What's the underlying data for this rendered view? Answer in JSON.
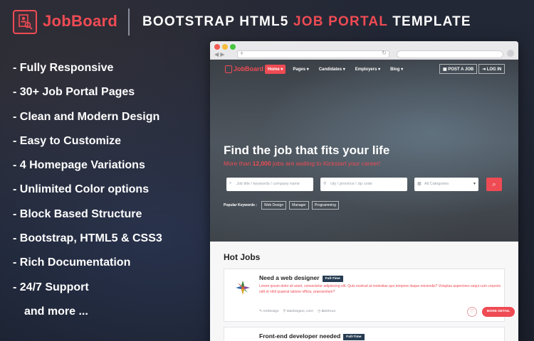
{
  "brand": {
    "logo_text": "JobBoard",
    "tagline_part1": "BOOTSTRAP HTML5 ",
    "tagline_part2": "JOB PORTAL",
    "tagline_part3": " TEMPLATE",
    "accent_color": "#ef4b54"
  },
  "features": [
    "- Fully Responsive",
    "- 30+ Job Portal Pages",
    "- Clean and Modern Design",
    "- Easy to Customize",
    "- 4 Homepage Variations",
    "- Unlimited Color options",
    "- Block Based Structure",
    "- Bootstrap, HTML5 & CSS3",
    "- Rich Documentation",
    "- 24/7 Support",
    "and more ..."
  ],
  "site": {
    "logo_text": "JobBoard",
    "menu": [
      "Home ▾",
      "Pages ▾",
      "Candidates ▾",
      "Employers ▾",
      "Blog ▾"
    ],
    "post_job": "POST A JOB",
    "login": "LOG IN",
    "hero_title": "Find the job that fits your life",
    "hero_sub_prefix": "More than ",
    "hero_sub_count": "12,000",
    "hero_sub_suffix": " jobs are waiting to Kickstart your career!",
    "keyword_placeholder": "Job title / keywords / company name",
    "location_placeholder": "city / province / zip code",
    "category_value": "All Categories",
    "popular_label": "Popular Keywords :",
    "popular_tags": [
      "Web Design",
      "Manager",
      "Programming"
    ]
  },
  "hot_jobs": {
    "title": "Hot Jobs",
    "jobs": [
      {
        "title": "Need a web designer",
        "type": "Full-Time",
        "description": "Lorem ipsum dolor sit amet, consectetur adipisicing elit. Quis nostrud at molestias quo tempore itaque reiciendis? Voluptas asperiores sequi cum corporis odit et nihil quaerat ratione officia, praesentium?",
        "category": "Art/Design",
        "location": "Washington, USA",
        "rate": "$50/Hour",
        "action": "MORE DETAIL"
      },
      {
        "title": "Front-end developer needed",
        "type": "Full-Time"
      }
    ]
  }
}
